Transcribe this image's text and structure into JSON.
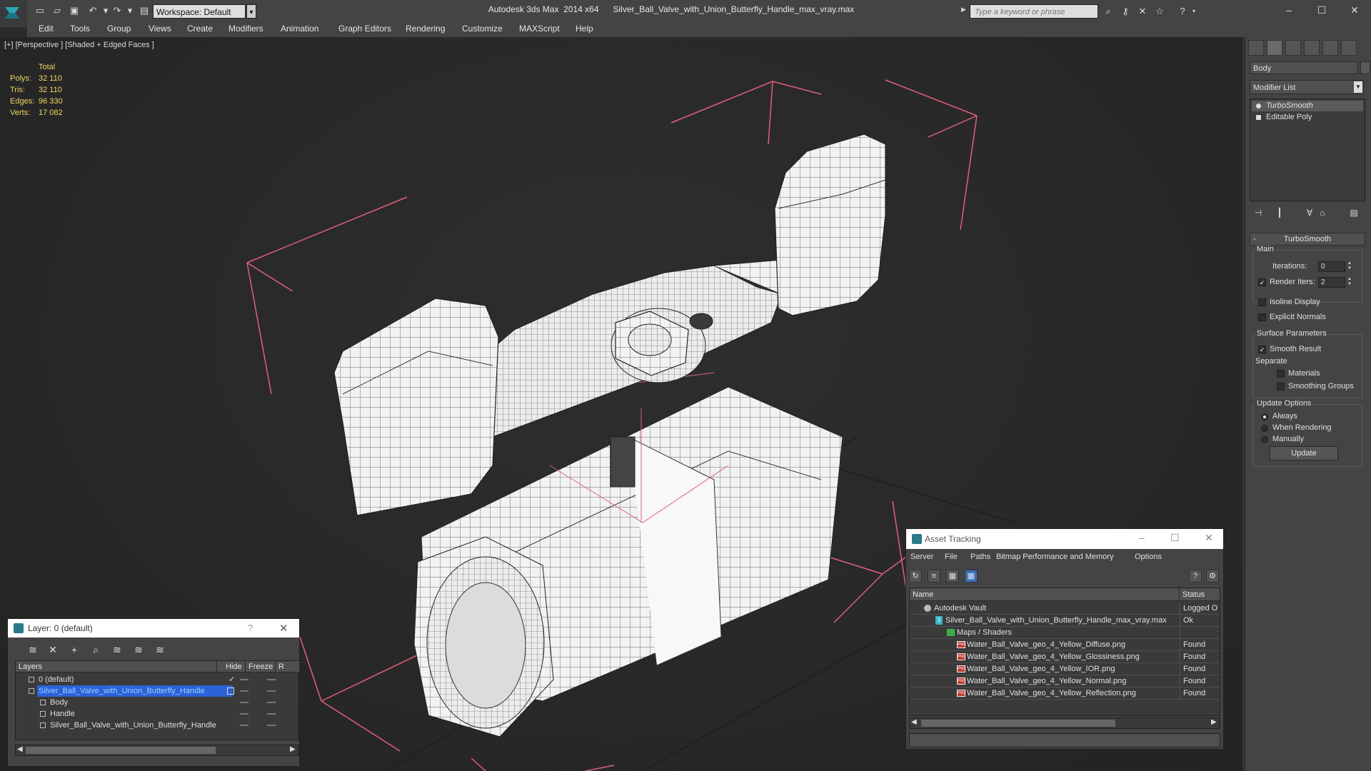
{
  "titlebar": {
    "app_title": "Autodesk 3ds Max  2014 x64",
    "file_title": "Silver_Ball_Valve_with_Union_Butterfly_Handle_max_vray.max",
    "workspace_label": "Workspace: Default",
    "search_placeholder": "Type a keyword or phrase",
    "icons": [
      "new-file-icon",
      "open-icon",
      "save-icon",
      "undo-icon",
      "redo-icon",
      "project-icon",
      "binoculars-icon",
      "key-icon",
      "exchange-icon",
      "star-icon",
      "help-icon"
    ]
  },
  "menubar": {
    "items": [
      "Edit",
      "Tools",
      "Group",
      "Views",
      "Create",
      "Modifiers",
      "Animation",
      "Graph Editors",
      "Rendering",
      "Customize",
      "MAXScript",
      "Help"
    ]
  },
  "viewport": {
    "label": "[+] [Perspective ] [Shaded + Edged Faces ]",
    "stats": {
      "header": "Total",
      "rows": [
        {
          "key": "Polys:",
          "value": "32 110"
        },
        {
          "key": "Tris:",
          "value": "32 110"
        },
        {
          "key": "Edges:",
          "value": "96 330"
        },
        {
          "key": "Verts:",
          "value": "17 082"
        }
      ]
    },
    "colors": {
      "bbox": "#e0607a",
      "stats": "#f0d860",
      "wire": "#2f2f2f",
      "mesh": "#f2f2f2"
    }
  },
  "command_panel": {
    "object_name": "Body",
    "modifier_list": "Modifier List",
    "stack": [
      "TurboSmooth",
      "Editable Poly"
    ],
    "rollout_title": "TurboSmooth",
    "main_label": "Main",
    "iterations_label": "Iterations:",
    "iterations_value": "0",
    "render_iters_label": "Render Iters:",
    "render_iters_value": "2",
    "isoline_label": "Isoline Display",
    "explicit_normals_label": "Explicit Normals",
    "surface_params_label": "Surface Parameters",
    "smooth_result_label": "Smooth Result",
    "separate_label": "Separate",
    "materials_label": "Materials",
    "smoothing_groups_label": "Smoothing Groups",
    "update_options_label": "Update Options",
    "always_label": "Always",
    "when_rendering_label": "When Rendering",
    "manually_label": "Manually",
    "update_button": "Update",
    "rollout_pm": "-"
  },
  "layer_dialog": {
    "title": "Layer: 0 (default)",
    "help": "?",
    "close": "✕",
    "columns": [
      "Layers",
      "Hide",
      "Freeze",
      "R"
    ],
    "rows": [
      {
        "name": "0 (default)",
        "indent": 1
      },
      {
        "name": "Silver_Ball_Valve_with_Union_Butterfly_Handle",
        "indent": 1,
        "selected": true
      },
      {
        "name": "Body",
        "indent": 2
      },
      {
        "name": "Handle",
        "indent": 2
      },
      {
        "name": "Silver_Ball_Valve_with_Union_Butterfly_Handle",
        "indent": 2
      }
    ]
  },
  "asset_dialog": {
    "title": "Asset Tracking",
    "menu": [
      "Server",
      "File",
      "Paths",
      "Bitmap Performance and Memory",
      "Options"
    ],
    "columns": [
      "Name",
      "Status"
    ],
    "rows": [
      {
        "name": "Autodesk Vault",
        "status": "Logged O",
        "icon": "vault",
        "indent": 1
      },
      {
        "name": "Silver_Ball_Valve_with_Union_Butterfly_Handle_max_vray.max",
        "status": "Ok",
        "icon": "file",
        "indent": 2
      },
      {
        "name": "Maps / Shaders",
        "status": "",
        "icon": "folder",
        "indent": 3
      },
      {
        "name": "Water_Ball_Valve_geo_4_Yellow_Diffuse.png",
        "status": "Found",
        "icon": "png",
        "indent": 4
      },
      {
        "name": "Water_Ball_Valve_geo_4_Yellow_Glossiness.png",
        "status": "Found",
        "icon": "png",
        "indent": 4
      },
      {
        "name": "Water_Ball_Valve_geo_4_Yellow_IOR.png",
        "status": "Found",
        "icon": "png",
        "indent": 4
      },
      {
        "name": "Water_Ball_Valve_geo_4_Yellow_Normal.png",
        "status": "Found",
        "icon": "png",
        "indent": 4
      },
      {
        "name": "Water_Ball_Valve_geo_4_Yellow_Reflection.png",
        "status": "Found",
        "icon": "png",
        "indent": 4
      }
    ]
  }
}
